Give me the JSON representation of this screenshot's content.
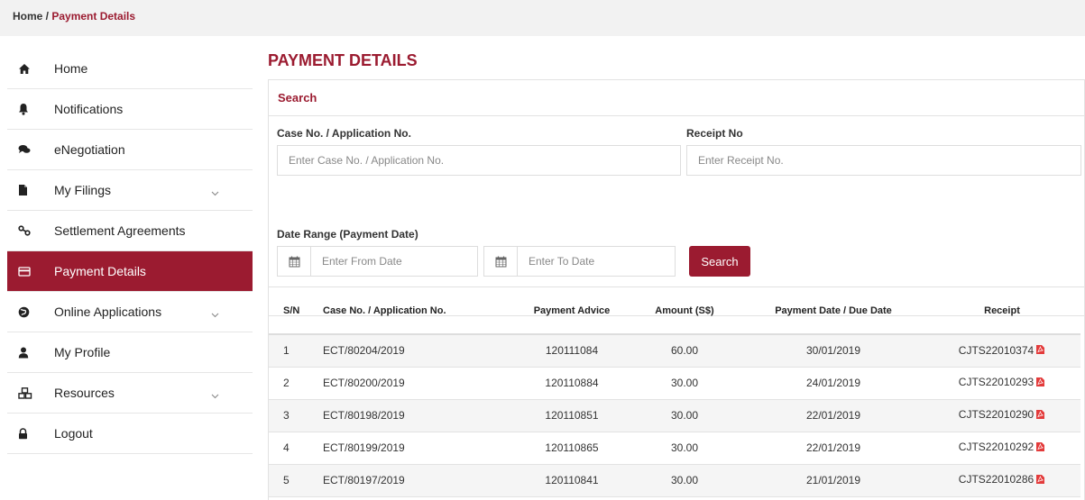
{
  "breadcrumb": {
    "home": "Home",
    "separator": " / ",
    "current": "Payment Details"
  },
  "colors": {
    "accent": "#9b1b30",
    "stripe": "#f5f5f5",
    "border": "#e2e2e2"
  },
  "sidebar": {
    "items": [
      {
        "label": "Home",
        "icon": "home-icon",
        "active": false,
        "expandable": false
      },
      {
        "label": "Notifications",
        "icon": "bell-icon",
        "active": false,
        "expandable": false
      },
      {
        "label": "eNegotiation",
        "icon": "chat-icon",
        "active": false,
        "expandable": false
      },
      {
        "label": "My Filings",
        "icon": "file-icon",
        "active": false,
        "expandable": true
      },
      {
        "label": "Settlement Agreements",
        "icon": "handshake-icon",
        "active": false,
        "expandable": false
      },
      {
        "label": "Payment Details",
        "icon": "credit-card-icon",
        "active": true,
        "expandable": false
      },
      {
        "label": "Online Applications",
        "icon": "globe-icon",
        "active": false,
        "expandable": true
      },
      {
        "label": "My Profile",
        "icon": "user-icon",
        "active": false,
        "expandable": false
      },
      {
        "label": "Resources",
        "icon": "cubes-icon",
        "active": false,
        "expandable": true
      },
      {
        "label": "Logout",
        "icon": "lock-icon",
        "active": false,
        "expandable": false
      }
    ]
  },
  "page": {
    "title": "PAYMENT DETAILS"
  },
  "search": {
    "title": "Search",
    "case_label": "Case No. / Application No.",
    "case_placeholder": "Enter Case No. / Application No.",
    "receipt_label": "Receipt No",
    "receipt_placeholder": "Enter Receipt No.",
    "date_label": "Date Range (Payment Date)",
    "from_placeholder": "Enter From Date",
    "to_placeholder": "Enter To Date",
    "button_label": "Search"
  },
  "table": {
    "headers": [
      "S/N",
      "Case No. / Application No.",
      "Payment Advice",
      "Amount (S$)",
      "Payment Date / Due Date",
      "Receipt"
    ],
    "rows": [
      [
        "1",
        "ECT/80204/2019",
        "120111084",
        "60.00",
        "30/01/2019",
        "CJTS22010374"
      ],
      [
        "2",
        "ECT/80200/2019",
        "120110884",
        "30.00",
        "24/01/2019",
        "CJTS22010293"
      ],
      [
        "3",
        "ECT/80198/2019",
        "120110851",
        "30.00",
        "22/01/2019",
        "CJTS22010290"
      ],
      [
        "4",
        "ECT/80199/2019",
        "120110865",
        "30.00",
        "22/01/2019",
        "CJTS22010292"
      ],
      [
        "5",
        "ECT/80197/2019",
        "120110841",
        "30.00",
        "21/01/2019",
        "CJTS22010286"
      ]
    ]
  }
}
